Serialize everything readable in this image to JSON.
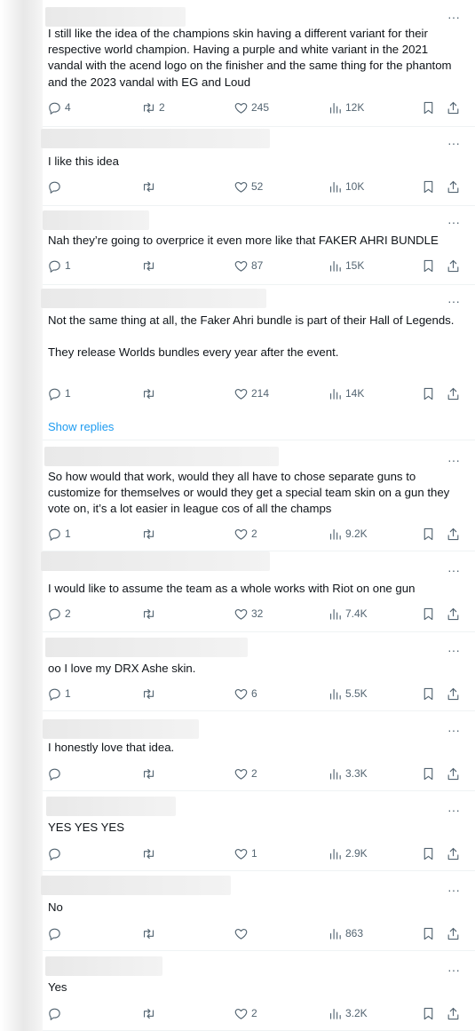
{
  "icons": {
    "more": "more-horizontal-icon",
    "reply": "reply-icon",
    "retweet": "retweet-icon",
    "like": "heart-icon",
    "views": "views-bar-chart-icon",
    "bookmark": "bookmark-icon",
    "share": "share-icon"
  },
  "more_glyph": "···",
  "show_replies_label": "Show replies",
  "posts": [
    {
      "text": "I still like the idea of the champions skin having a different variant for their respective world champion. Having a purple and white variant in the 2021 vandal with the acend logo on the finisher and the same thing for the phantom and the 2023 vandal with EG and Loud",
      "replies": "4",
      "reposts": "2",
      "likes": "245",
      "views": "12K"
    },
    {
      "text": "I like this idea",
      "replies": "",
      "reposts": "",
      "likes": "52",
      "views": "10K"
    },
    {
      "text": "Nah they’re going to overprice it even more like that FAKER AHRI BUNDLE",
      "replies": "1",
      "reposts": "",
      "likes": "87",
      "views": "15K"
    },
    {
      "text": "Not the same thing at all, the Faker Ahri bundle is part of their Hall of Legends.\n\nThey release Worlds bundles every year after the event.",
      "replies": "1",
      "reposts": "",
      "likes": "214",
      "views": "14K"
    },
    {
      "text": "So how would that work, would they all have to chose separate guns to customize for themselves or would they get a special team skin on a gun they vote on, it’s a lot easier in league cos of all the champs",
      "replies": "1",
      "reposts": "",
      "likes": "2",
      "views": "9.2K"
    },
    {
      "text": "I would like to assume the team as a whole works with Riot on one gun",
      "replies": "2",
      "reposts": "",
      "likes": "32",
      "views": "7.4K"
    },
    {
      "text": "oo I love my DRX Ashe skin.",
      "replies": "1",
      "reposts": "",
      "likes": "6",
      "views": "5.5K"
    },
    {
      "text": "I honestly love that idea.",
      "replies": "",
      "reposts": "",
      "likes": "2",
      "views": "3.3K"
    },
    {
      "text": "YES YES YES",
      "replies": "",
      "reposts": "",
      "likes": "1",
      "views": "2.9K"
    },
    {
      "text": "No",
      "replies": "",
      "reposts": "",
      "likes": "",
      "views": "863"
    },
    {
      "text": "Yes",
      "replies": "",
      "reposts": "",
      "likes": "2",
      "views": "3.2K"
    }
  ]
}
